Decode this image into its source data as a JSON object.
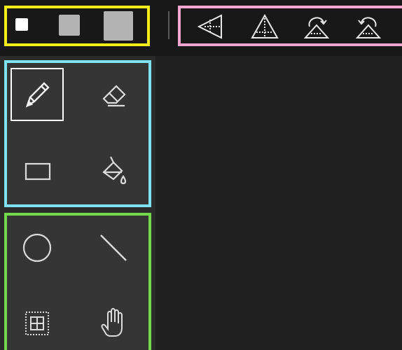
{
  "toolbar": {
    "brush_sizes": [
      {
        "name": "brush-size-small",
        "color": "#ffffff"
      },
      {
        "name": "brush-size-medium",
        "color": "#b3b3b3"
      },
      {
        "name": "brush-size-large",
        "color": "#b3b3b3"
      }
    ],
    "transform_icons": [
      "flip-horizontal-icon",
      "flip-vertical-icon",
      "rotate-right-icon",
      "rotate-left-icon"
    ]
  },
  "tools": {
    "group_1": [
      {
        "icon": "pencil-icon",
        "selected": true
      },
      {
        "icon": "eraser-icon",
        "selected": false
      },
      {
        "icon": "rectangle-icon",
        "selected": false
      },
      {
        "icon": "paint-bucket-icon",
        "selected": false
      }
    ],
    "group_2": [
      {
        "icon": "circle-icon",
        "selected": false
      },
      {
        "icon": "line-icon",
        "selected": false
      },
      {
        "icon": "grid-select-icon",
        "selected": false
      },
      {
        "icon": "hand-icon",
        "selected": false
      }
    ]
  },
  "colors": {
    "brush_group_outline": "#f5ec1a",
    "transform_group_outline": "#f6a6cf",
    "tool_group_1_outline": "#7ee3f7",
    "tool_group_2_outline": "#72d94b"
  }
}
